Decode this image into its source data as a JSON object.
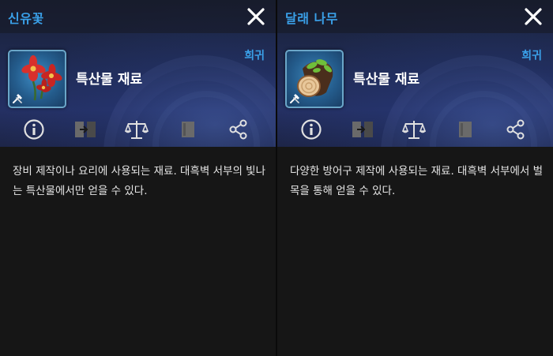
{
  "panels": [
    {
      "title": "신유꽃",
      "grade": "희귀",
      "category": "특산물 재료",
      "item_icon": "red-flower-icon",
      "badge_icon": "crafting-tools-icon",
      "description": "장비 제작이나 요리에 사용되는 재료. 대흑벽 서부의 빛나는 특산물에서만 얻을 수 있다.",
      "actions": [
        {
          "icon": "info-icon",
          "enabled": true
        },
        {
          "icon": "compare-icon",
          "enabled": false
        },
        {
          "icon": "scale-icon",
          "enabled": true
        },
        {
          "icon": "book-icon",
          "enabled": false
        },
        {
          "icon": "share-icon",
          "enabled": true
        }
      ]
    },
    {
      "title": "달래 나무",
      "grade": "희귀",
      "category": "특산물 재료",
      "item_icon": "wood-log-icon",
      "badge_icon": "crafting-tools-icon",
      "description": "다양한 방어구 제작에 사용되는 재료. 대흑벽 서부에서 벌목을 통해 얻을 수 있다.",
      "actions": [
        {
          "icon": "info-icon",
          "enabled": true
        },
        {
          "icon": "compare-icon",
          "enabled": false
        },
        {
          "icon": "scale-icon",
          "enabled": true
        },
        {
          "icon": "book-icon",
          "enabled": false
        },
        {
          "icon": "share-icon",
          "enabled": true
        }
      ]
    }
  ],
  "colors": {
    "accent": "#3aa0e8",
    "text": "#e6e6e6",
    "background": "#161616",
    "icon_enabled": "#e0e0e0",
    "icon_disabled": "#6a6a6a"
  }
}
